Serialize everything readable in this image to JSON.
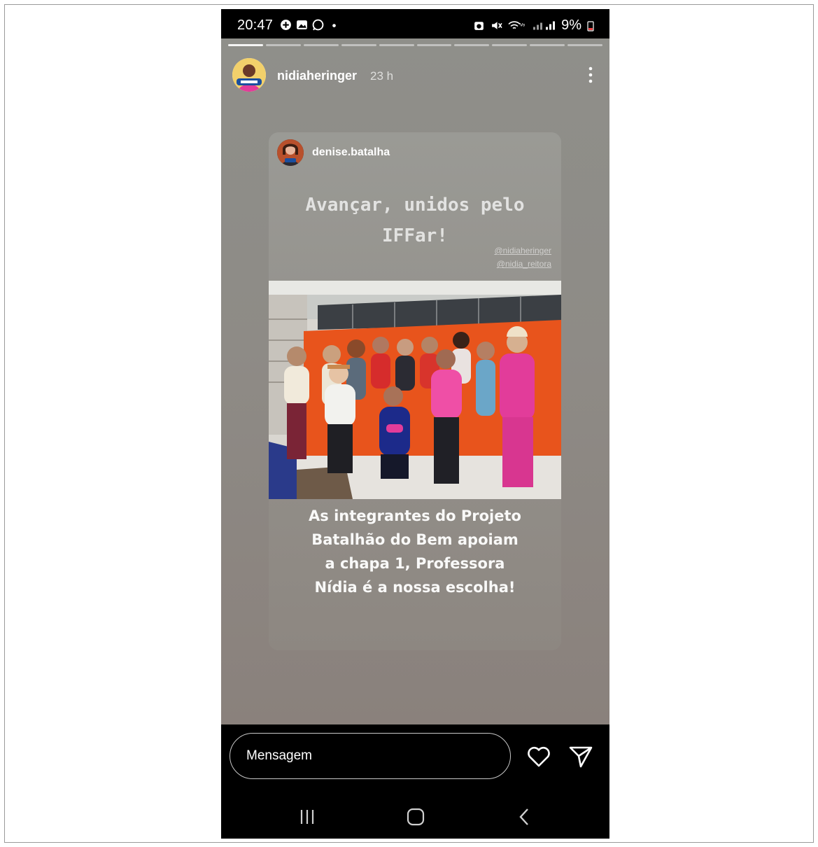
{
  "statusbar": {
    "time": "20:47",
    "battery": "9%",
    "left_icons": [
      "nfc-icon",
      "gallery-icon",
      "whatsapp-icon",
      "dot-icon"
    ],
    "right_icons": [
      "alarm-icon",
      "mute-icon",
      "wifi-icon",
      "signal-icon"
    ]
  },
  "story": {
    "progress_segments": 10,
    "progress_current": 1,
    "username": "nidiaheringer",
    "time_ago": "23 h"
  },
  "card": {
    "username": "denise.batalha",
    "headline_line1": "Avançar, unidos pelo",
    "headline_line2": "IFFar!",
    "mention1": "@nidiaheringer",
    "mention2": "@nidia_reitora",
    "caption_line1": "As integrantes do Projeto",
    "caption_line2": "Batalhão do Bem apoiam",
    "caption_line3": "a chapa 1, Professora",
    "caption_line4": "Nídia é a nossa escolha!"
  },
  "bottom": {
    "message_placeholder": "Mensagem"
  },
  "colors": {
    "story_bg": "#8e8b86",
    "photo_wall": "#e8541c",
    "accent_pink": "#e23c9a"
  }
}
